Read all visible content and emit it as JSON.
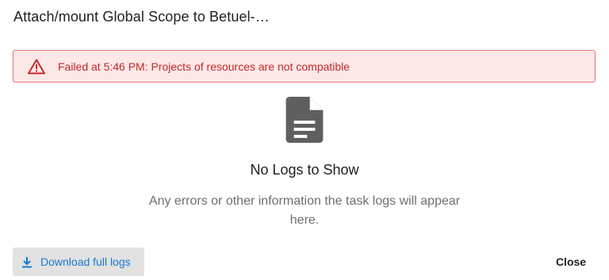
{
  "dialog": {
    "title": "Attach/mount Global Scope to Betuel-…"
  },
  "alert": {
    "icon": "warning-triangle-icon",
    "message": "Failed at 5:46 PM: Projects of resources are not compatible",
    "text_color": "#c62828",
    "background_color": "#fde8e8",
    "border_color": "#e57373"
  },
  "empty_state": {
    "icon": "document-icon",
    "title": "No Logs to Show",
    "description": "Any errors or other information the task logs will appear here."
  },
  "footer": {
    "download_label": "Download full logs",
    "download_icon": "download-icon",
    "close_label": "Close",
    "accent_color": "#1976d2"
  }
}
